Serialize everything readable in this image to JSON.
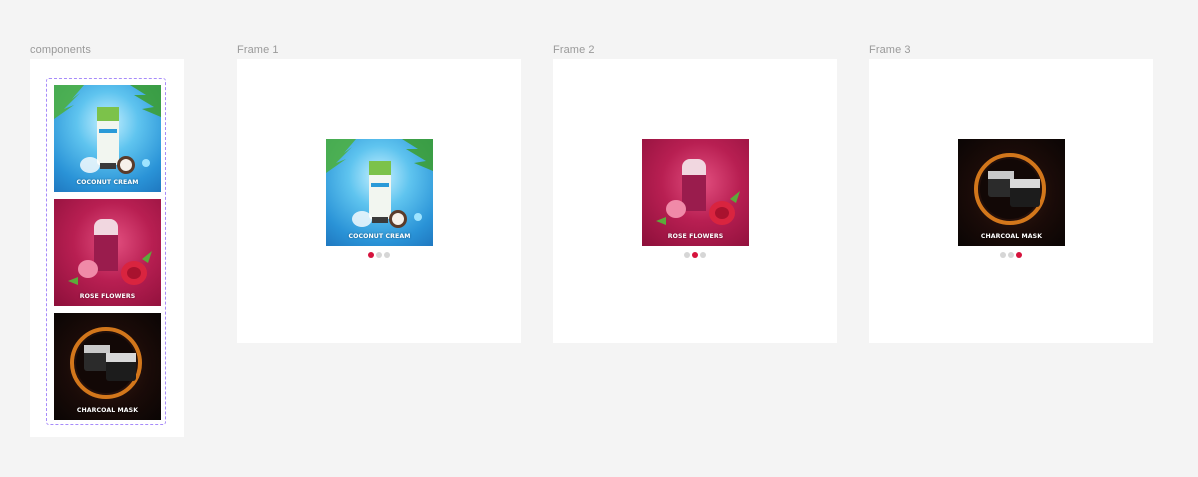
{
  "canvas": {
    "background": "#f4f4f4"
  },
  "labels": {
    "components": "components",
    "frame1": "Frame 1",
    "frame2": "Frame 2",
    "frame3": "Frame 3"
  },
  "slides": [
    {
      "caption": "COCONUT CREAM",
      "theme": "coconut"
    },
    {
      "caption": "ROSE FLOWERS",
      "theme": "rose"
    },
    {
      "caption": "CHARCOAL MASK",
      "theme": "charcoal"
    }
  ],
  "carousel_dots": {
    "frame1_active": 1,
    "frame2_active": 2,
    "frame3_active": 3,
    "total": 3,
    "active_color": "#d6133d",
    "inactive_color": "#d6d6d6"
  },
  "selection_color": "#a78bfa"
}
